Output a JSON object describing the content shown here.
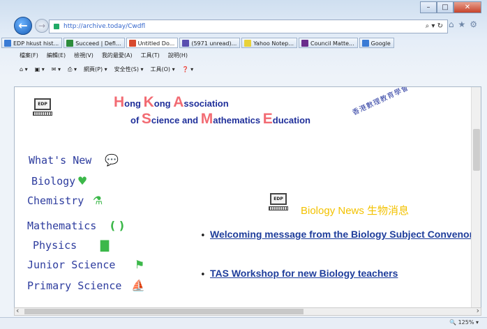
{
  "browser": {
    "url": "http://archive.today/Cwdfl",
    "tabs": [
      {
        "label": "EDP hkust hist...",
        "color": "#3a7bd5"
      },
      {
        "label": "Succeed | Defi...",
        "color": "#2d8c3c"
      },
      {
        "label": "Untitled Do...",
        "color": "#d84a2e"
      },
      {
        "label": "(5971 unread)...",
        "color": "#5a4fb0"
      },
      {
        "label": "Yahoo Notep...",
        "color": "#e8d23a"
      },
      {
        "label": "Council Matte...",
        "color": "#6a2c8c"
      },
      {
        "label": "Google",
        "color": "#3a7bd5"
      }
    ],
    "menu": [
      "檔案(F)",
      "編輯(E)",
      "檢視(V)",
      "我的最愛(A)",
      "工具(T)",
      "說明(H)"
    ],
    "commands": [
      "▾",
      "▾",
      "▾",
      "網頁(P) ▾",
      "安全性(S) ▾",
      "工具(O) ▾",
      "▾"
    ],
    "zoom": "125%"
  },
  "page": {
    "logo_label": "EDP",
    "association": {
      "line1": [
        {
          "cap": "H",
          "rest": "ong "
        },
        {
          "cap": "K",
          "rest": "ong "
        },
        {
          "cap": "A",
          "rest": "ssociation"
        }
      ],
      "line2": [
        {
          "cap": "",
          "rest": "of "
        },
        {
          "cap": "S",
          "rest": "cience and "
        },
        {
          "cap": "M",
          "rest": "athematics "
        },
        {
          "cap": "E",
          "rest": "ducation"
        }
      ],
      "chinese": "香港數理教育學會"
    },
    "nav": [
      {
        "label": "What's New",
        "icon": "chat-icon"
      },
      {
        "label": "Biology",
        "icon": "heart-icon"
      },
      {
        "label": "Chemistry",
        "icon": "flask-icon"
      },
      {
        "label": "Mathematics",
        "icon": "parentheses-icon"
      },
      {
        "label": "Physics",
        "icon": "device-icon"
      },
      {
        "label": "Junior Science",
        "icon": "ladder-icon"
      },
      {
        "label": "Primary Science",
        "icon": "boat-icon"
      }
    ],
    "news_title": "Biology News 生物消息",
    "news": [
      {
        "title": "Welcoming message from the Biology Subject Convenor"
      },
      {
        "title": "TAS Workshop for new Biology teachers"
      }
    ]
  }
}
